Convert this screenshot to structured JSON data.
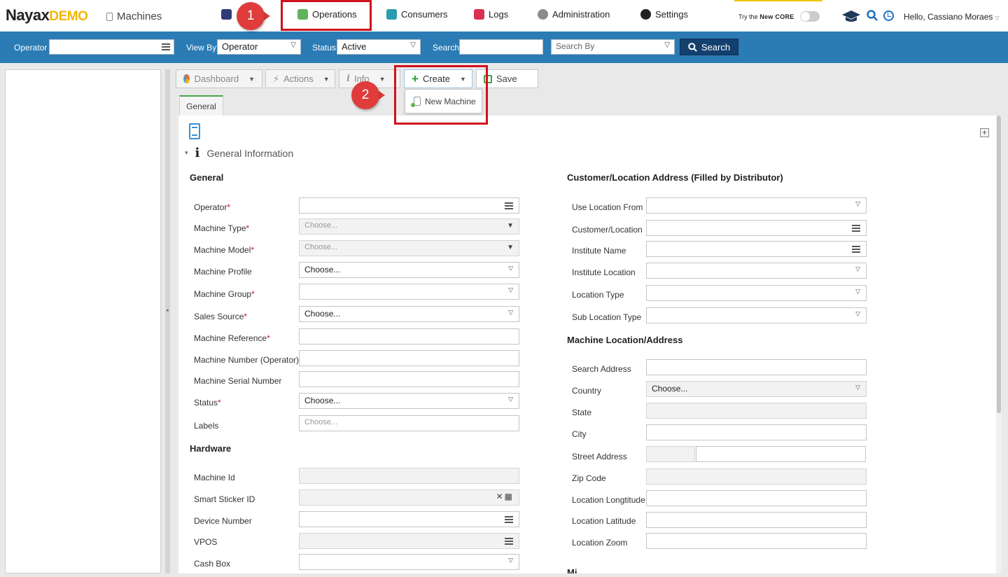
{
  "header": {
    "logo_main": "Nayax",
    "logo_suffix": "DEMO",
    "page_title": "Machines",
    "nav": [
      {
        "label": "Operations",
        "icon": "operations-icon"
      },
      {
        "label": "Consumers",
        "icon": "consumers-icon"
      },
      {
        "label": "Logs",
        "icon": "logs-icon"
      },
      {
        "label": "Administration",
        "icon": "administration-icon"
      },
      {
        "label": "Settings",
        "icon": "settings-icon"
      }
    ],
    "try_core_prefix": "Try the ",
    "try_core_new": "New ",
    "try_core_brand": "CORE",
    "greeting": "Hello, Cassiano Moraes"
  },
  "filters": {
    "operator_label": "Operator",
    "operator_value": "",
    "view_by_label": "View By",
    "view_by_value": "Operator",
    "status_label": "Status",
    "status_value": "Active",
    "search_label": "Search",
    "search_value": "",
    "search_by_placeholder": "Search By",
    "search_button": "Search"
  },
  "toolbar": {
    "dashboard": "Dashboard",
    "actions": "Actions",
    "info": "Info",
    "create": "Create",
    "save": "Save",
    "create_menu_item": "New Machine"
  },
  "annotations": {
    "step1": "1",
    "step2": "2",
    "highlight_color": "#d0101d",
    "badge_color": "#e03c3c"
  },
  "tabs": {
    "general": "General"
  },
  "section_header": "General Information",
  "general": {
    "title": "General",
    "fields": [
      {
        "label": "Operator",
        "required": "*",
        "value": ""
      },
      {
        "label": "Machine Type",
        "required": "*",
        "value": "Choose..."
      },
      {
        "label": "Machine Model",
        "required": "*",
        "value": "Choose..."
      },
      {
        "label": "Machine Profile",
        "required": "",
        "value": "Choose..."
      },
      {
        "label": "Machine Group",
        "required": "*",
        "value": ""
      },
      {
        "label": "Sales Source",
        "required": "*",
        "value": "Choose..."
      },
      {
        "label": "Machine Reference",
        "required": "*",
        "value": ""
      },
      {
        "label": "Machine Number (Operator)",
        "required": "",
        "value": ""
      },
      {
        "label": "Machine Serial Number",
        "required": "",
        "value": ""
      },
      {
        "label": "Status",
        "required": "*",
        "value": "Choose..."
      },
      {
        "label": "Labels",
        "required": "",
        "value": "Choose..."
      }
    ]
  },
  "hardware": {
    "title": "Hardware",
    "fields": [
      {
        "label": "Machine Id",
        "value": ""
      },
      {
        "label": "Smart Sticker ID",
        "value": ""
      },
      {
        "label": "Device Number",
        "value": ""
      },
      {
        "label": "VPOS",
        "value": ""
      },
      {
        "label": "Cash Box",
        "value": ""
      }
    ]
  },
  "customer_location": {
    "title": "Customer/Location Address (Filled by Distributor)",
    "fields": [
      {
        "label": "Use Location From",
        "value": ""
      },
      {
        "label": "Customer/Location",
        "value": ""
      },
      {
        "label": "Institute Name",
        "value": ""
      },
      {
        "label": "Institute Location",
        "value": ""
      },
      {
        "label": "Location Type",
        "value": ""
      },
      {
        "label": "Sub Location Type",
        "value": ""
      }
    ]
  },
  "machine_location": {
    "title": "Machine Location/Address",
    "fields": [
      {
        "label": "Search Address",
        "value": ""
      },
      {
        "label": "Country",
        "value": "Choose..."
      },
      {
        "label": "State",
        "value": ""
      },
      {
        "label": "City",
        "value": ""
      },
      {
        "label": "Street Address",
        "value": ""
      },
      {
        "label": "Zip Code",
        "value": ""
      },
      {
        "label": "Location Longtitude",
        "value": ""
      },
      {
        "label": "Location Latitude",
        "value": ""
      },
      {
        "label": "Location Zoom",
        "value": ""
      }
    ]
  },
  "next_section_partial": "Mi"
}
